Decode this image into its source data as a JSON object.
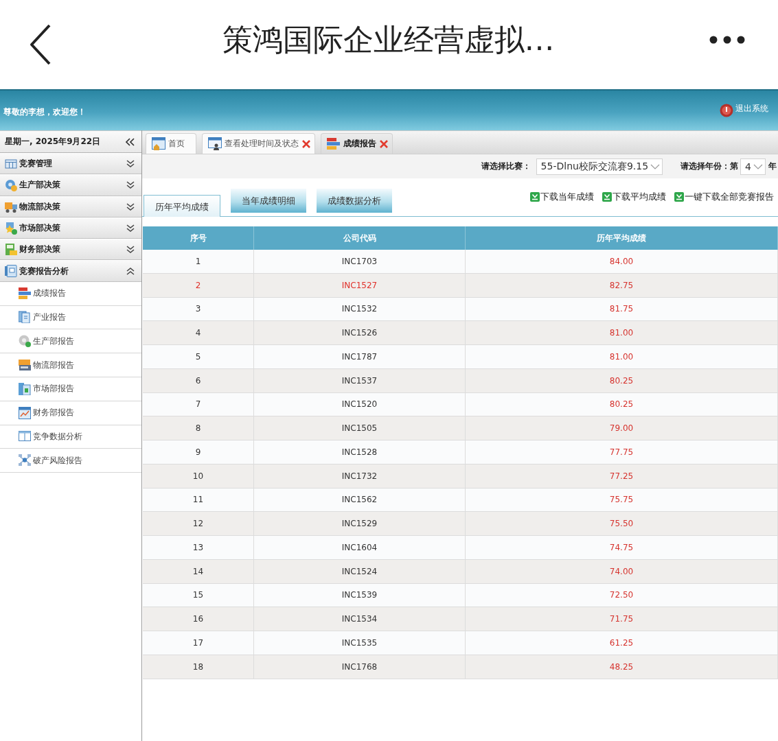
{
  "app_bar": {
    "title": "策鸿国际企业经营虚拟…"
  },
  "header": {
    "greeting": "尊敬的李想，欢迎您！",
    "logout": "退出系统"
  },
  "sidebar": {
    "date": "星期一, 2025年9月22日",
    "groups": [
      {
        "label": "竞赛管理",
        "expanded": false
      },
      {
        "label": "生产部决策",
        "expanded": false
      },
      {
        "label": "物流部决策",
        "expanded": false
      },
      {
        "label": "市场部决策",
        "expanded": false
      },
      {
        "label": "财务部决策",
        "expanded": false
      },
      {
        "label": "竞赛报告分析",
        "expanded": true,
        "children": [
          {
            "label": "成绩报告"
          },
          {
            "label": "产业报告"
          },
          {
            "label": "生产部报告"
          },
          {
            "label": "物流部报告"
          },
          {
            "label": "市场部报告"
          },
          {
            "label": "财务部报告"
          },
          {
            "label": "竞争数据分析"
          },
          {
            "label": "破产风险报告"
          }
        ]
      }
    ]
  },
  "tabs": [
    {
      "label": "首页",
      "selected": false,
      "closable": false
    },
    {
      "label": "查看处理时间及状态",
      "selected": false,
      "closable": true
    },
    {
      "label": "成绩报告",
      "selected": true,
      "closable": true
    }
  ],
  "filters": {
    "contest_label": "请选择比赛：",
    "contest": "55-Dlnu校际交流赛9.15",
    "year_label": "请选择年份：",
    "year_prefix": "第",
    "year": "4",
    "year_suffix": "年"
  },
  "report_tabs": [
    {
      "label": "历年平均成绩",
      "selected": true
    },
    {
      "label": "当年成绩明细",
      "selected": false
    },
    {
      "label": "成绩数据分析",
      "selected": false
    }
  ],
  "downloads": [
    "下载当年成绩",
    "下载平均成绩",
    "一键下载全部竞赛报告"
  ],
  "table": {
    "columns": [
      "序号",
      "公司代码",
      "历年平均成绩"
    ],
    "rows": [
      {
        "cells": [
          "1",
          "INC1703",
          "84.00"
        ],
        "highlighted": false
      },
      {
        "cells": [
          "2",
          "INC1527",
          "82.75"
        ],
        "highlighted": true
      },
      {
        "cells": [
          "3",
          "INC1532",
          "81.75"
        ],
        "highlighted": false
      },
      {
        "cells": [
          "4",
          "INC1526",
          "81.00"
        ],
        "highlighted": false
      },
      {
        "cells": [
          "5",
          "INC1787",
          "81.00"
        ],
        "highlighted": false
      },
      {
        "cells": [
          "6",
          "INC1537",
          "80.25"
        ],
        "highlighted": false
      },
      {
        "cells": [
          "7",
          "INC1520",
          "80.25"
        ],
        "highlighted": false
      },
      {
        "cells": [
          "8",
          "INC1505",
          "79.00"
        ],
        "highlighted": false
      },
      {
        "cells": [
          "9",
          "INC1528",
          "77.75"
        ],
        "highlighted": false
      },
      {
        "cells": [
          "10",
          "INC1732",
          "77.25"
        ],
        "highlighted": false
      },
      {
        "cells": [
          "11",
          "INC1562",
          "75.75"
        ],
        "highlighted": false
      },
      {
        "cells": [
          "12",
          "INC1529",
          "75.50"
        ],
        "highlighted": false
      },
      {
        "cells": [
          "13",
          "INC1604",
          "74.75"
        ],
        "highlighted": false
      },
      {
        "cells": [
          "14",
          "INC1524",
          "74.00"
        ],
        "highlighted": false
      },
      {
        "cells": [
          "15",
          "INC1539",
          "72.50"
        ],
        "highlighted": false
      },
      {
        "cells": [
          "16",
          "INC1534",
          "71.75"
        ],
        "highlighted": false
      },
      {
        "cells": [
          "17",
          "INC1535",
          "61.25"
        ],
        "highlighted": false
      },
      {
        "cells": [
          "18",
          "INC1768",
          "48.25"
        ],
        "highlighted": false
      }
    ]
  }
}
